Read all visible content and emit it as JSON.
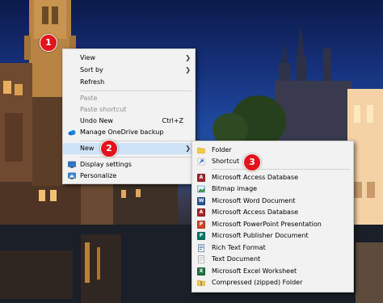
{
  "context_menu": {
    "view": "View",
    "sort_by": "Sort by",
    "refresh": "Refresh",
    "paste": "Paste",
    "paste_shortcut": "Paste shortcut",
    "undo_new": "Undo New",
    "undo_new_shortcut": "Ctrl+Z",
    "manage_onedrive": "Manage OneDrive backup",
    "new": "New",
    "display_settings": "Display settings",
    "personalize": "Personalize"
  },
  "new_submenu": {
    "items": [
      {
        "label": "Folder",
        "icon": "folder-icon"
      },
      {
        "label": "Shortcut",
        "icon": "shortcut-icon"
      },
      {
        "label": "Microsoft Access Database",
        "icon": "access-icon"
      },
      {
        "label": "Bitmap image",
        "icon": "bitmap-icon"
      },
      {
        "label": "Microsoft Word Document",
        "icon": "word-icon"
      },
      {
        "label": "Microsoft Access Database",
        "icon": "access-icon"
      },
      {
        "label": "Microsoft PowerPoint Presentation",
        "icon": "powerpoint-icon"
      },
      {
        "label": "Microsoft Publisher Document",
        "icon": "publisher-icon"
      },
      {
        "label": "Rich Text Format",
        "icon": "rtf-icon"
      },
      {
        "label": "Text Document",
        "icon": "text-document-icon"
      },
      {
        "label": "Microsoft Excel Worksheet",
        "icon": "excel-icon"
      },
      {
        "label": "Compressed (zipped) Folder",
        "icon": "zip-folder-icon"
      }
    ]
  },
  "callouts": [
    "1",
    "2",
    "3"
  ],
  "colors": {
    "menu_background": "#f2f2f2",
    "highlight": "#cfe3f7",
    "callout_red": "#e3131b",
    "disabled_text": "#8c8c8c"
  }
}
